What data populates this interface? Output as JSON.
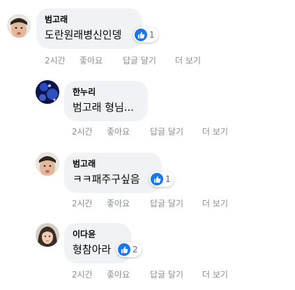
{
  "comments": [
    {
      "author": "범고래",
      "text": "도란원래병신인뎅",
      "reaction_count": "1",
      "time": "2시간",
      "like_label": "좋아요",
      "reply_label": "답글 달기",
      "more_label": "더 보기"
    },
    {
      "author": "한누리",
      "text": "범고래 형님...",
      "time": "2시간",
      "like_label": "좋아요",
      "reply_label": "답글 달기",
      "more_label": "더 보기"
    },
    {
      "author": "범고래",
      "text": "ㅋㅋ패주구싶음",
      "reaction_count": "1",
      "time": "2시간",
      "like_label": "좋아요",
      "reply_label": "답글 달기",
      "more_label": "더 보기"
    },
    {
      "author": "이다윤",
      "text": "형참아라",
      "reaction_count": "2",
      "time": "2시간",
      "like_label": "좋아요",
      "reply_label": "답글 달기",
      "more_label": "더 보기"
    }
  ],
  "icons": {
    "reaction": "thumbs-up-icon",
    "avatar": "profile-photo"
  },
  "colors": {
    "bubble": "#f0f2f5",
    "like_blue": "#1877f2",
    "meta_text": "#8a8d91"
  }
}
